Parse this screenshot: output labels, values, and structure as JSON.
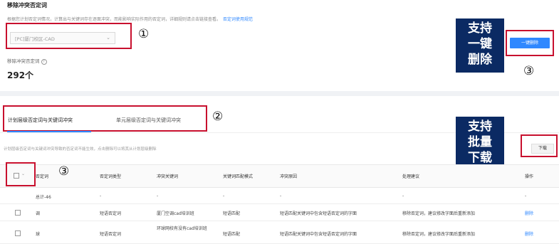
{
  "header": {
    "title": "移除冲突否定词",
    "description": "根据您计划否定词情况，计算出与关键词存在逐面冲突，而能影响实际作用的否定词，详细规则请点击链接查看。",
    "rules_link": "否定词使用规范"
  },
  "scope_select": {
    "value": "[PC]厦门校区-CAD",
    "chevron": "chevron-down-icon"
  },
  "markers": {
    "m1": "①",
    "m2": "②",
    "m3_table": "③",
    "m3_button": "③"
  },
  "summary": {
    "label": "移除冲突否定词",
    "count": "292个",
    "help_icon": "?"
  },
  "callouts": {
    "one_click": [
      "支持",
      "一键",
      "删除"
    ],
    "bulk_download": [
      "支持",
      "批量",
      "下载"
    ]
  },
  "buttons": {
    "one_click_delete": "一键删除",
    "download": "下载"
  },
  "tabs": [
    {
      "label": "计划层级否定词与关键词冲突"
    },
    {
      "label": "单元层级否定词与关键词冲突"
    }
  ],
  "tip": "计划层级否定词与关键词冲突导致的否定词不能生效，点击删除可以将其从计划层级删除",
  "table": {
    "headers": [
      "否定词",
      "否定词类型",
      "冲突关键词",
      "关键词匹配模式",
      "冲突原因",
      "处理建议",
      "操作"
    ],
    "total_row": {
      "label": "总计-46",
      "cells": [
        "-",
        "-",
        "-",
        "-",
        "-",
        "-"
      ]
    },
    "rows": [
      {
        "word": "调",
        "type": "短语否定词",
        "keyword": "厦门空调cad培训班",
        "match": "短语匹配",
        "reason": "短语匹配关键词中包含短语否定词的字面",
        "advice": "移除否定词，建议修改字面后重新添加",
        "action": "删除"
      },
      {
        "word": "球",
        "type": "短语否定词",
        "keyword": "环球网校有没有cad培训班",
        "match": "短语匹配",
        "reason": "短语匹配关键词中包含短语否定词的字面",
        "advice": "移除否定词，建议修改字面后重新添加",
        "action": "删除"
      }
    ]
  },
  "colors": {
    "accent": "#2f88ff",
    "callout_bg": "#0b2a63",
    "annotation_red": "#c8102e"
  }
}
